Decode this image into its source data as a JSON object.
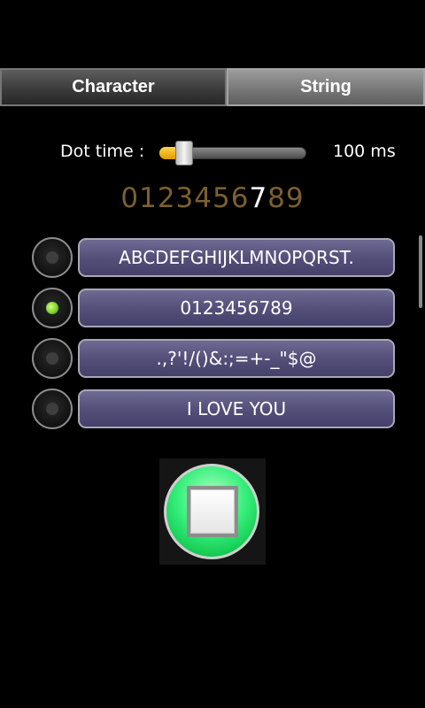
{
  "tabs": [
    {
      "label": "Character",
      "active": true
    },
    {
      "label": "String",
      "active": false
    }
  ],
  "dot_time": {
    "label": "Dot time :",
    "value_text": "100 ms",
    "slider_level": 0.12
  },
  "digits": {
    "before": "0123456",
    "highlight": "7",
    "after": "89"
  },
  "options": [
    {
      "label": "ABCDEFGHIJKLMNOPQRST.",
      "selected": false
    },
    {
      "label": "0123456789",
      "selected": true
    },
    {
      "label": ".,?'!/()&:;=+-_\"$@",
      "selected": false
    },
    {
      "label": "I LOVE YOU",
      "selected": false
    }
  ],
  "colors": {
    "accent_green": "#38f07d",
    "option_button": "#55507a",
    "slider_fill": "#f2b11a",
    "digit_dim": "#7c5f2e"
  },
  "icons": {
    "stop": "stop-icon"
  }
}
